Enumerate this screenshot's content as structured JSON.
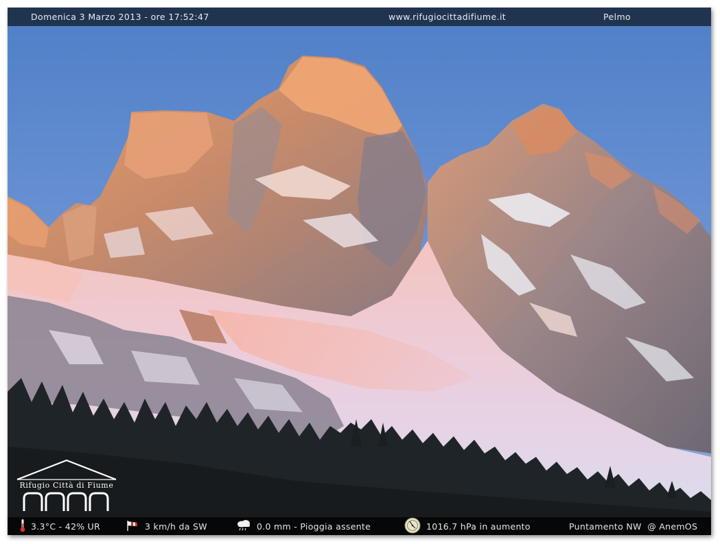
{
  "header": {
    "datetime": "Domenica 3 Marzo 2013 - ore 17:52:47",
    "website": "www.rifugiocittadifiume.it",
    "peak": "Pelmo"
  },
  "logo": {
    "text": "Rifugio Città di Fiume",
    "icon": "hut-arches-logo"
  },
  "footer": {
    "temperature_humidity": "3.3°C - 42% UR",
    "wind": "3 km/h da SW",
    "rain": "0.0 mm - Pioggia assente",
    "pressure": "1016.7 hPa in aumento",
    "pointing": "Puntamento NW  @ AnemOS",
    "icons": [
      "thermometer-icon",
      "windsock-icon",
      "rain-cloud-icon",
      "barometer-icon"
    ]
  },
  "colors": {
    "sky": "#5a88cc",
    "alpenglow": "#e08a5a",
    "snow": "#e9eef6",
    "forest": "#1c2226"
  }
}
